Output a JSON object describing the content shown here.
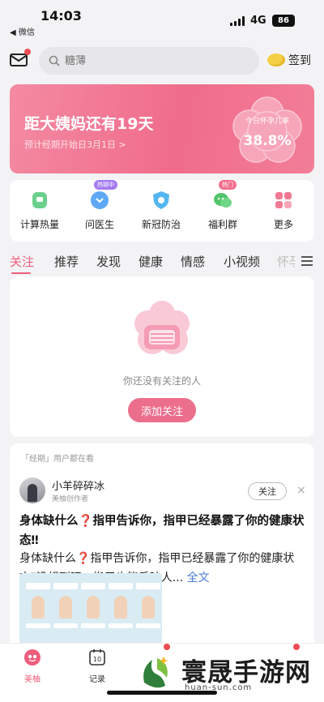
{
  "status_bar": {
    "time": "14:03",
    "back_label": "◀ 微信",
    "network": "4G",
    "battery": "86"
  },
  "header": {
    "search_placeholder": "糖薄",
    "signin_label": "签到"
  },
  "banner": {
    "title": "距大姨妈还有19天",
    "subtitle": "预计经期开始日3月1日 >",
    "pregnancy_label": "今日怀孕几率",
    "pregnancy_value": "38.8%"
  },
  "quick_actions": [
    {
      "label": "计算热量",
      "icon": "calculator-icon",
      "tag": ""
    },
    {
      "label": "问医生",
      "icon": "doctor-chat-icon",
      "tag": "热聊中"
    },
    {
      "label": "新冠防治",
      "icon": "shield-icon",
      "tag": ""
    },
    {
      "label": "福利群",
      "icon": "wechat-group-icon",
      "tag": "热门"
    },
    {
      "label": "更多",
      "icon": "grid-more-icon",
      "tag": ""
    }
  ],
  "tabs": [
    "关注",
    "推荐",
    "发现",
    "健康",
    "情感",
    "小视频",
    "怀孕"
  ],
  "empty_follow": {
    "text": "你还没有关注的人",
    "button": "添加关注"
  },
  "feed_card": {
    "hint": "「经期」用户都在看",
    "author_name": "小羊碎碎冰",
    "author_role": "美柚创作者",
    "follow_label": "关注",
    "close_label": "×",
    "title": "身体缺什么❓指甲告诉你，指甲已经暴露了你的健康状态‼",
    "body": "身体缺什么❓指甲告诉你，指甲已经暴露了你的健康状态‼没想到吧，指甲也能反映人...",
    "more_label": "全文",
    "thumb_labels": [
      "",
      "",
      "",
      "",
      ""
    ]
  },
  "bottom_nav": [
    {
      "label": "美柚",
      "icon": "home-logo-icon",
      "active": true
    },
    {
      "label": "记录",
      "icon": "calendar-icon",
      "active": false
    }
  ],
  "watermark": {
    "brand_cn": "寰晟手游网",
    "brand_url": "huan-sun.com"
  },
  "colors": {
    "accent": "#ef5d7c",
    "banner_start": "#f48aa2",
    "banner_end": "#f06c8c",
    "link": "#4a7bd6"
  }
}
